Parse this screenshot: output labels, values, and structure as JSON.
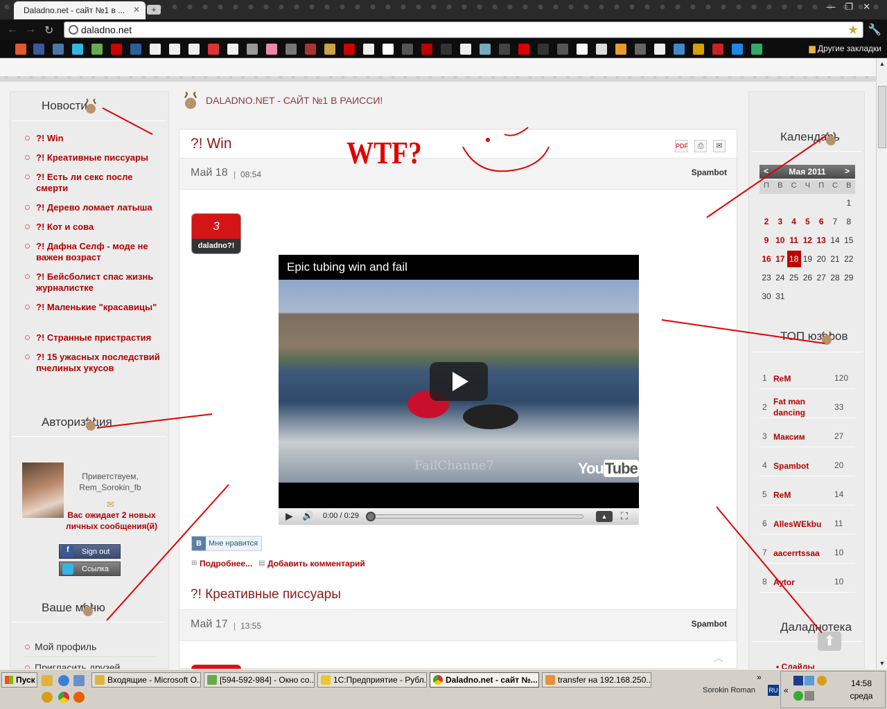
{
  "browser": {
    "tab_title": "Daladno.net - сайт №1 в ...",
    "url": "daladno.net",
    "other_bookmarks": "Другие закладки"
  },
  "site": {
    "header": "DALADNO.NET - САЙТ №1 В РАИССИ!"
  },
  "left": {
    "news_title": "Новости",
    "news": [
      "?! Win",
      "?! Креативные писсуары",
      "?! Есть ли секс после смерти",
      "?! Дерево ломает латыша",
      "?! Кот и сова",
      "?! Дафна Селф - моде не важен возраст",
      "?! Бейсболист спас жизнь журналистке",
      "?! Маленькие \"красавицы\"",
      "?! Странные пристрастия",
      "?! 15 ужасных последствий пчелиных укусов"
    ],
    "auth_title": "Авторизация",
    "greeting": "Приветствуем,",
    "username": "Rem_Sorokin_fb",
    "messages": "Вас ожидает 2 новых личных сообщения(й)",
    "sign_out": "Sign out",
    "link": "Ссылка",
    "menu_title": "Ваше меню",
    "menu_items": [
      "Мой профиль",
      "Пригласить друзей"
    ]
  },
  "article1": {
    "title": "?! Win",
    "month_day": "Май 18",
    "time": "08:54",
    "author": "Spambot",
    "vote_count": "3",
    "vote_label": "daladno?!",
    "video_title": "Epic tubing win and fail",
    "watermark": "FailChanne7",
    "video_time": "0:00 / 0:29",
    "like": "Мне нравится",
    "more": "Подробнее...",
    "comment": "Добавить комментарий"
  },
  "article2": {
    "title": "?! Креативные писсуары",
    "month_day": "Май 17",
    "time": "13:55",
    "author": "Spambot"
  },
  "annotation": {
    "wtf": "WTF?"
  },
  "calendar": {
    "title": "Календарь",
    "month": "Мая 2011",
    "prev": "<",
    "next": ">",
    "weekdays": [
      "П",
      "В",
      "С",
      "Ч",
      "П",
      "С",
      "В"
    ],
    "rows": [
      [
        "",
        "",
        "",
        "",
        "",
        "",
        "1"
      ],
      [
        "2",
        "3",
        "4",
        "5",
        "6",
        "7",
        "8"
      ],
      [
        "9",
        "10",
        "11",
        "12",
        "13",
        "14",
        "15"
      ],
      [
        "16",
        "17",
        "18",
        "19",
        "20",
        "21",
        "22"
      ],
      [
        "23",
        "24",
        "25",
        "26",
        "27",
        "28",
        "29"
      ],
      [
        "30",
        "31",
        "",
        "",
        "",
        "",
        ""
      ]
    ],
    "today": "18"
  },
  "top_users": {
    "title": "ТОП юзеров",
    "rows": [
      {
        "rank": "1",
        "name": "ReM",
        "score": "120"
      },
      {
        "rank": "2",
        "name": "Fat man dancing",
        "score": "33"
      },
      {
        "rank": "3",
        "name": "Максим",
        "score": "27"
      },
      {
        "rank": "4",
        "name": "Spambot",
        "score": "20"
      },
      {
        "rank": "5",
        "name": "ReM",
        "score": "14"
      },
      {
        "rank": "6",
        "name": "AllesWEkbu",
        "score": "11"
      },
      {
        "rank": "7",
        "name": "aacerrtssaa",
        "score": "10"
      },
      {
        "rank": "8",
        "name": "Aytor",
        "score": "10"
      }
    ]
  },
  "daladnoteka": {
    "title": "Даладнотека",
    "first_item": "Слайды"
  },
  "taskbar": {
    "start": "Пуск",
    "buttons": [
      "Входящие - Microsoft O...",
      "[594-592-984] - Окно со...",
      "1С:Предприятие - Рубл...",
      "Daladno.net - сайт №...",
      "transfer на 192.168.250...."
    ],
    "user": "Sorokin Roman",
    "lang": "RU",
    "time": "14:58",
    "day": "среда"
  },
  "colors": {
    "accent_red": "#b30000",
    "title_red": "#8a1a1a",
    "annotation_red": "#e00000"
  }
}
